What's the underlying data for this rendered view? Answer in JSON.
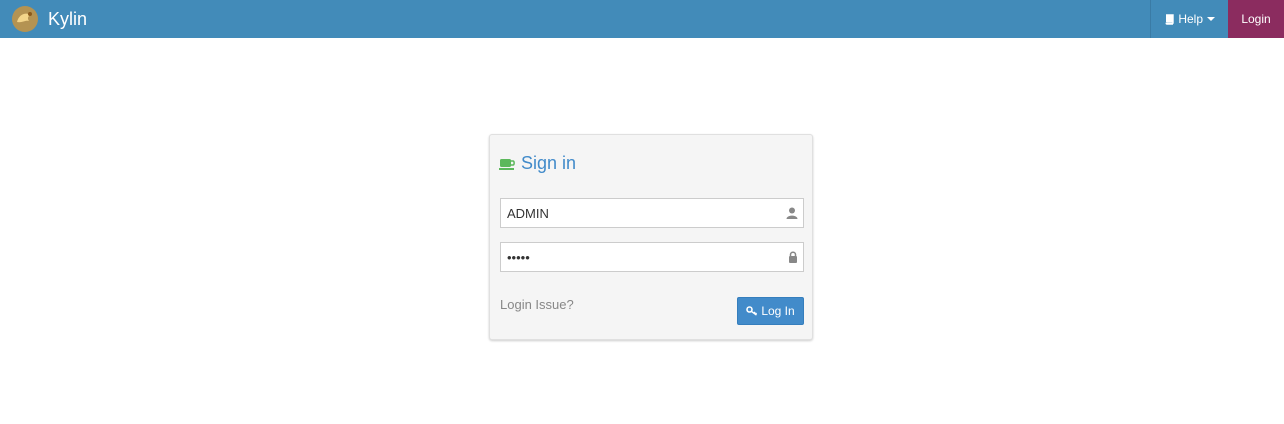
{
  "navbar": {
    "brand_name": "Kylin",
    "logo_icon": "kylin-logo",
    "help_label": "Help",
    "help_icon": "book-icon",
    "login_label": "Login",
    "colors": {
      "navbar_bg": "#428bb9",
      "login_bg": "#8b2c5f"
    }
  },
  "signin": {
    "title": "Sign in",
    "title_icon": "coffee-cup-icon",
    "username_value": "ADMIN",
    "username_icon": "user-icon",
    "password_value": "•••••",
    "password_icon": "lock-icon",
    "login_issue_label": "Login Issue?",
    "login_button_label": "Log In",
    "login_button_icon": "key-icon",
    "colors": {
      "title": "#428bca",
      "button_bg": "#428bca",
      "icon_green": "#5cb85c"
    }
  }
}
